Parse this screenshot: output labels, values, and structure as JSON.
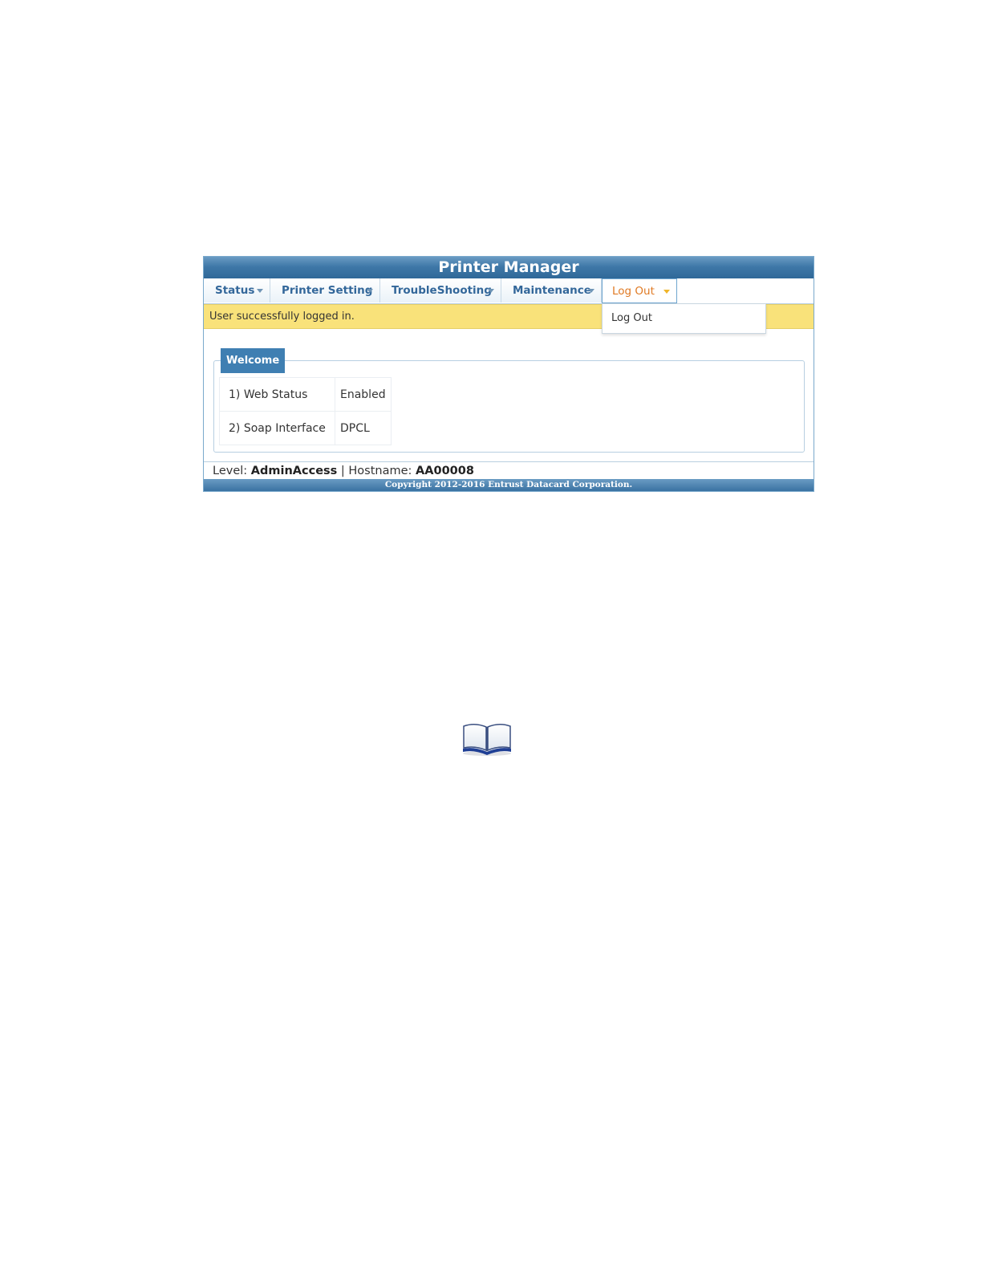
{
  "app": {
    "title": "Printer Manager"
  },
  "nav": {
    "items": [
      {
        "label": "Status"
      },
      {
        "label": "Printer Setting"
      },
      {
        "label": "TroubleShooting"
      },
      {
        "label": "Maintenance"
      },
      {
        "label": "Log Out",
        "active": true
      }
    ]
  },
  "notice": {
    "message": "User successfully logged in."
  },
  "dropdown": {
    "items": [
      {
        "label": "Log Out"
      }
    ]
  },
  "welcome": {
    "title": "Welcome",
    "rows": [
      {
        "label": "1) Web Status",
        "value": "Enabled"
      },
      {
        "label": "2) Soap Interface",
        "value": "DPCL"
      }
    ]
  },
  "footer": {
    "level_label": "Level:",
    "level_value": "AdminAccess",
    "separator": "|",
    "hostname_label": "Hostname:",
    "hostname_value": "AA00008",
    "copyright": "Copyright 2012-2016 Entrust Datacard Corporation."
  },
  "colors": {
    "header_blue": "#3f78a8",
    "notice_yellow": "#f9e27a",
    "active_tab_orange": "#e07a24",
    "nav_text_blue": "#33679a"
  },
  "icons": {
    "book": "open-book-icon"
  }
}
